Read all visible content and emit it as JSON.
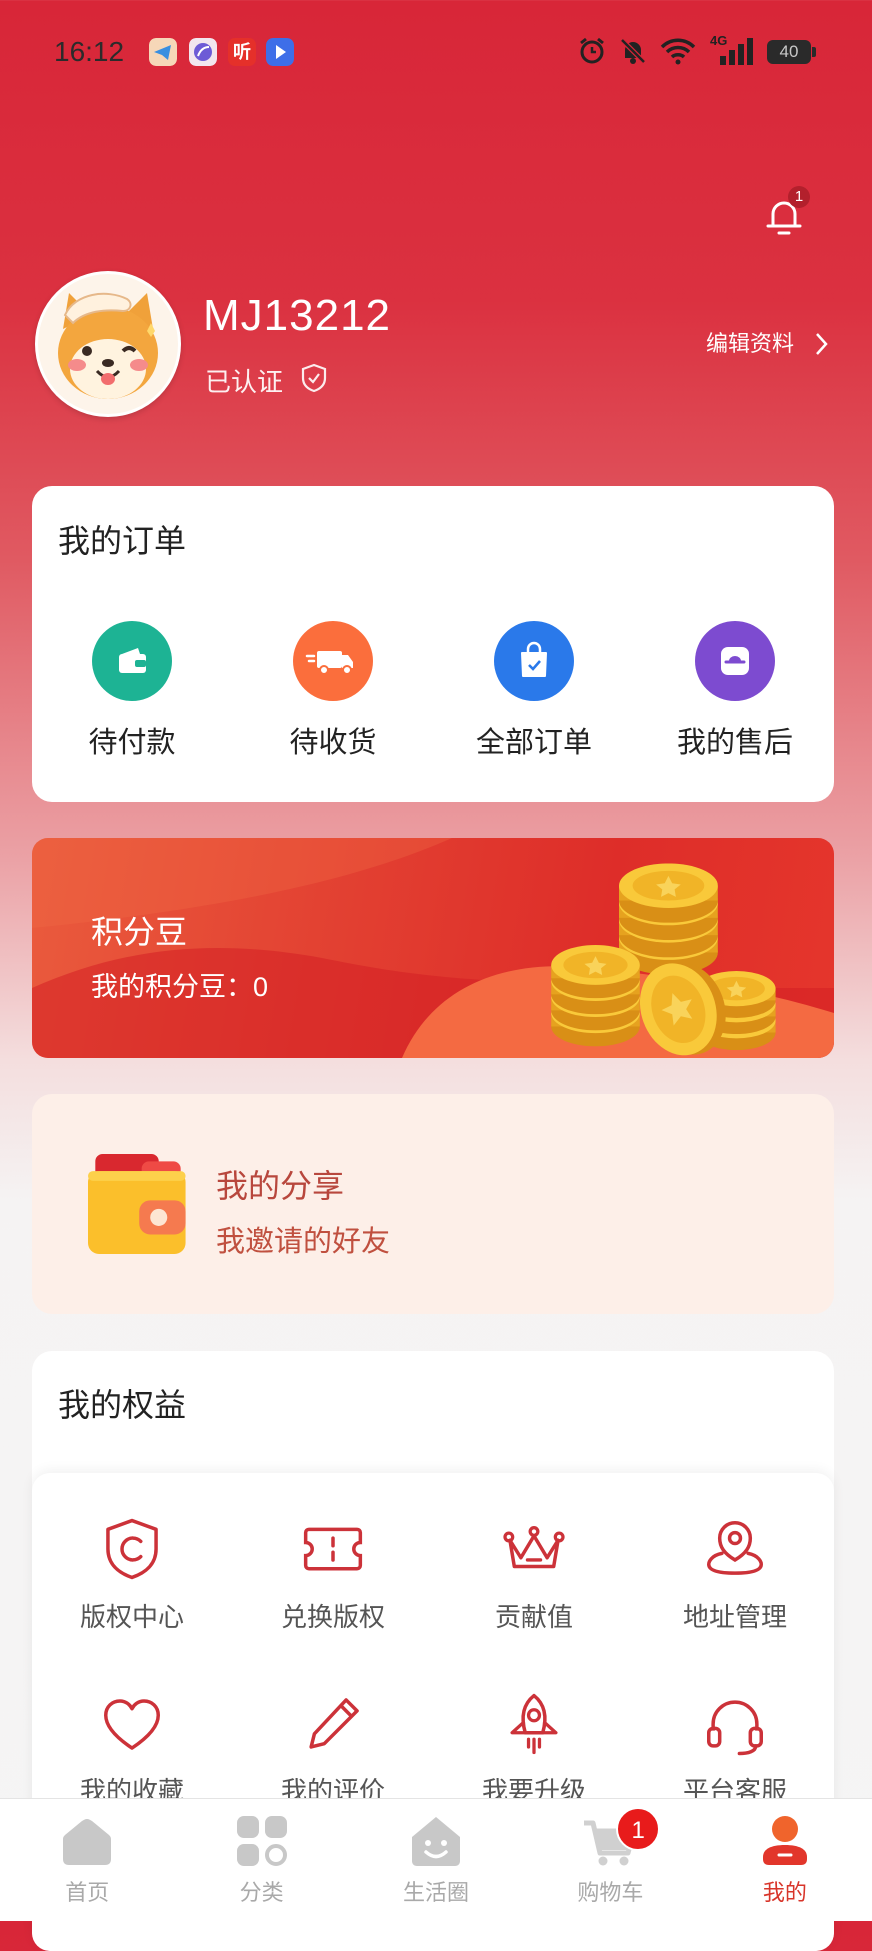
{
  "status_bar": {
    "time": "16:12",
    "notif_apps": [
      "telegram-app-icon",
      "purple-app-icon",
      "ting-app-icon",
      "blue-arrow-app-icon"
    ],
    "ting_label": "听",
    "network": "4G",
    "battery": "40",
    "right_icons": [
      "alarm-icon",
      "muted-bell-icon",
      "wifi-icon",
      "signal-icon",
      "battery-icon"
    ]
  },
  "header": {
    "bell_badge": "1",
    "username": "MJ13212",
    "verified": "已认证",
    "edit_profile": "编辑资料"
  },
  "orders": {
    "title": "我的订单",
    "items": [
      {
        "label": "待付款",
        "icon": "wallet-icon",
        "color": "#1db394"
      },
      {
        "label": "待收货",
        "icon": "truck-icon",
        "color": "#fb6e3c"
      },
      {
        "label": "全部订单",
        "icon": "shopping-bag-icon",
        "color": "#2a79ea"
      },
      {
        "label": "我的售后",
        "icon": "after-sale-icon",
        "color": "#7d4bd0"
      }
    ]
  },
  "points": {
    "title": "积分豆",
    "label": "我的积分豆：0"
  },
  "share": {
    "title": "我的分享",
    "subtitle": "我邀请的好友"
  },
  "rights": {
    "title": "我的权益",
    "items": [
      {
        "label": "版权中心",
        "icon": "copyright-shield-icon"
      },
      {
        "label": "兑换版权",
        "icon": "ticket-icon"
      },
      {
        "label": "贡献值",
        "icon": "crown-icon"
      },
      {
        "label": "地址管理",
        "icon": "address-icon"
      },
      {
        "label": "我的收藏",
        "icon": "heart-icon"
      },
      {
        "label": "我的评价",
        "icon": "pencil-icon"
      },
      {
        "label": "我要升级",
        "icon": "rocket-icon"
      },
      {
        "label": "平台客服",
        "icon": "headset-icon"
      }
    ]
  },
  "tabbar": {
    "items": [
      {
        "label": "首页",
        "icon": "house-icon"
      },
      {
        "label": "分类",
        "icon": "grid-icon"
      },
      {
        "label": "生活圈",
        "icon": "community-icon"
      },
      {
        "label": "购物车",
        "icon": "cart-icon"
      },
      {
        "label": "我的",
        "icon": "user-icon"
      }
    ],
    "cart_badge": "1",
    "active": "我的"
  },
  "colors": {
    "brand_red": "#d8352a",
    "icon_red": "#cc3239",
    "header_bg": "#d82638",
    "share_bg": "#fdefe8"
  }
}
